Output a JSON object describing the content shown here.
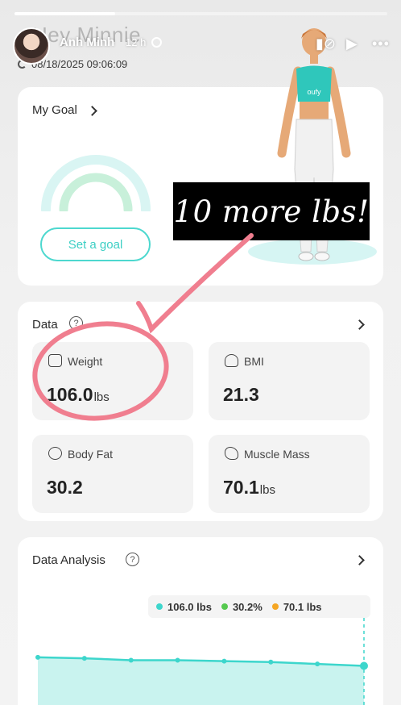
{
  "story": {
    "progress_fraction": 0.27,
    "poster_name": "Anh Minh",
    "time_ago": "12 h",
    "globe_icon": "globe-icon",
    "mute_icon": "mute-icon",
    "play_icon": "play-icon",
    "more_icon": "more-icon"
  },
  "app": {
    "greeting": "Hey Minnie",
    "timestamp": "08/18/2025 09:06:09"
  },
  "goal": {
    "title": "My Goal",
    "button_label": "Set a goal"
  },
  "overlay_banner": "10 more lbs!",
  "data_section": {
    "title": "Data",
    "metrics": [
      {
        "label": "Weight",
        "value": "106.0",
        "unit": "lbs",
        "icon": "scale-icon"
      },
      {
        "label": "BMI",
        "value": "21.3",
        "unit": "",
        "icon": "bmi-gauge-icon"
      },
      {
        "label": "Body Fat",
        "value": "30.2",
        "unit": "",
        "icon": "body-fat-icon"
      },
      {
        "label": "Muscle Mass",
        "value": "70.1",
        "unit": "lbs",
        "icon": "muscle-arm-icon"
      }
    ]
  },
  "analysis": {
    "title": "Data Analysis",
    "legend": [
      {
        "label": "106.0 lbs",
        "color": "#3dd6cc"
      },
      {
        "label": "30.2%",
        "color": "#56c94f"
      },
      {
        "label": "70.1 lbs",
        "color": "#f5a623"
      }
    ]
  },
  "figure_shirt_text": "oufy",
  "colors": {
    "accent": "#3ccfc4",
    "annotation": "#f07e8f"
  },
  "chart_data": {
    "type": "area",
    "series": [
      {
        "values": [
          106.9,
          106.8,
          106.6,
          106.6,
          106.5,
          106.4,
          106.2,
          106.0
        ]
      }
    ]
  }
}
